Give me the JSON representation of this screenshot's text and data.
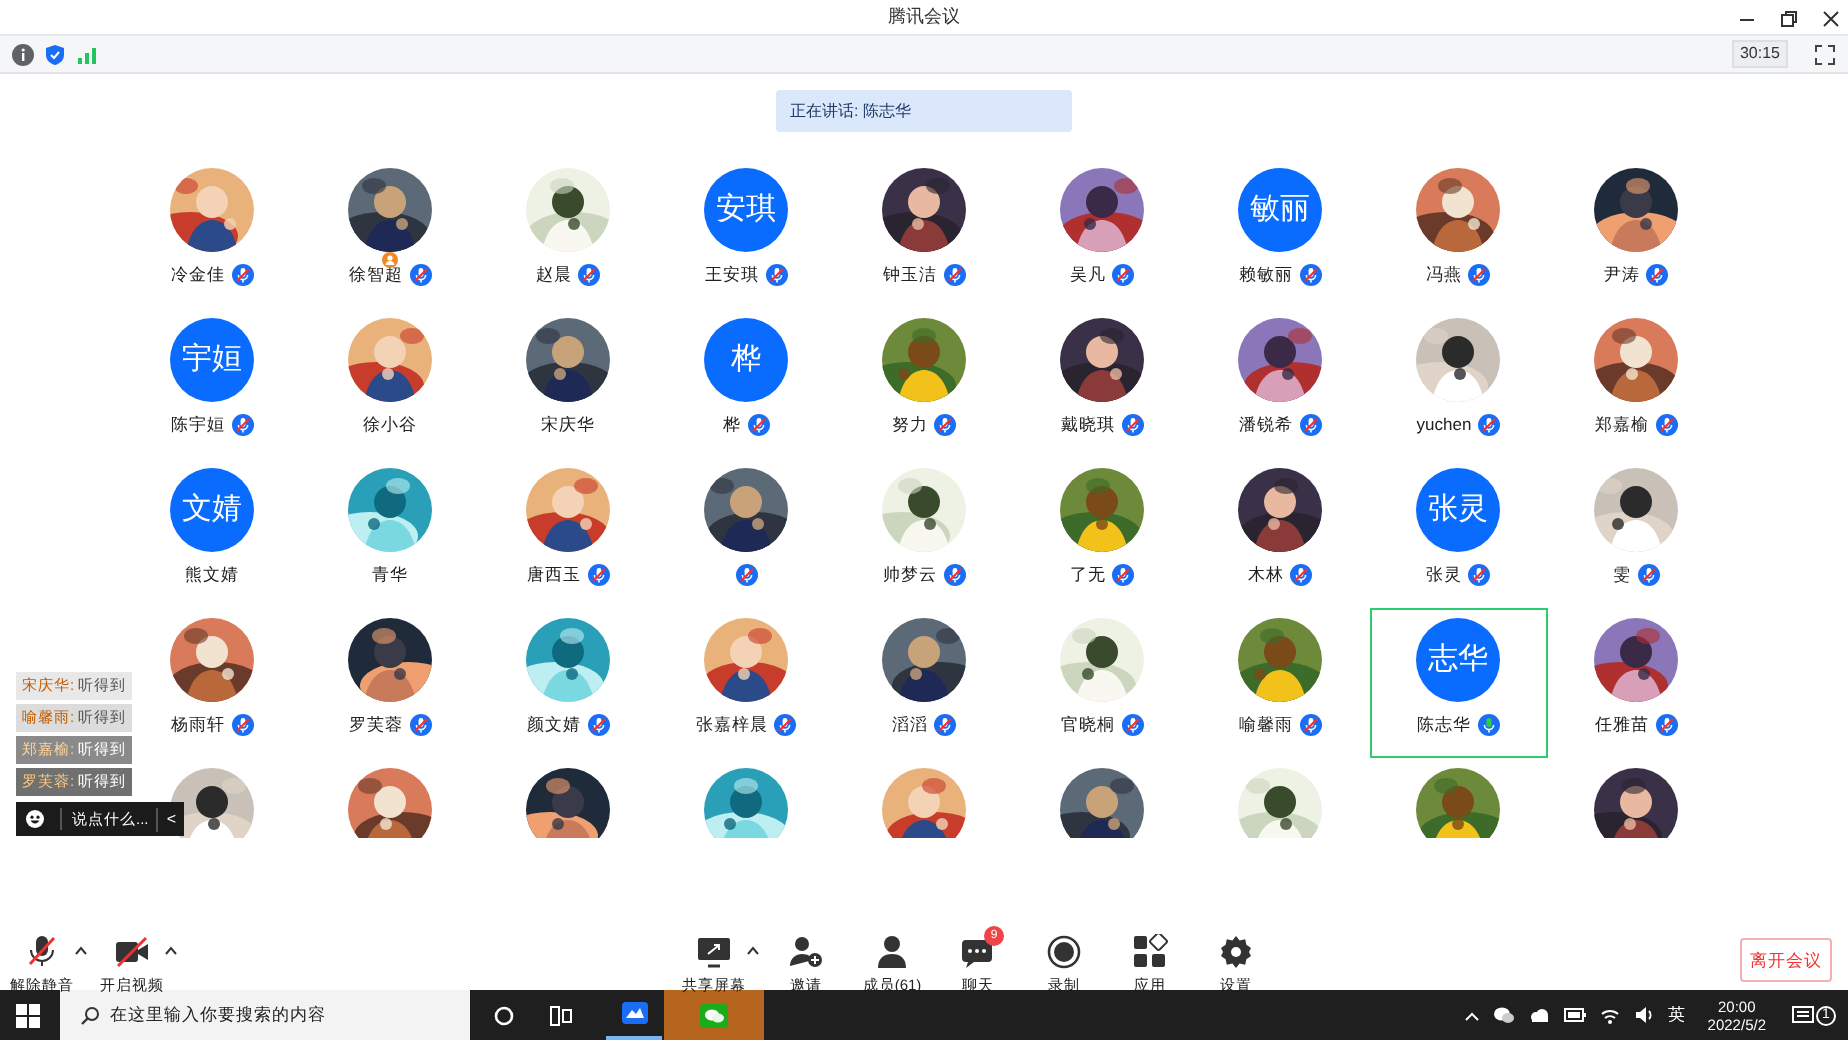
{
  "window": {
    "title": "腾讯会议"
  },
  "meeting_bar": {
    "timer": "30:15"
  },
  "speaking_banner": "正在讲话: 陈志华",
  "participants": [
    {
      "name": "冷金佳",
      "kind": "picture",
      "muted": true,
      "host": false,
      "selected": false
    },
    {
      "name": "徐智超",
      "kind": "picture",
      "muted": true,
      "host": true,
      "selected": false
    },
    {
      "name": "赵晨",
      "kind": "picture",
      "muted": true,
      "host": false,
      "selected": false
    },
    {
      "name": "王安琪",
      "kind": "initials",
      "initials": "安琪",
      "muted": true,
      "host": false,
      "selected": false
    },
    {
      "name": "钟玉洁",
      "kind": "picture",
      "muted": true,
      "host": false,
      "selected": false
    },
    {
      "name": "吴凡",
      "kind": "picture",
      "muted": true,
      "host": false,
      "selected": false
    },
    {
      "name": "赖敏丽",
      "kind": "initials",
      "initials": "敏丽",
      "muted": true,
      "host": false,
      "selected": false
    },
    {
      "name": "冯燕",
      "kind": "picture",
      "muted": true,
      "host": false,
      "selected": false
    },
    {
      "name": "尹涛",
      "kind": "picture",
      "muted": true,
      "host": false,
      "selected": false
    },
    {
      "name": "陈宇姮",
      "kind": "initials",
      "initials": "宇姮",
      "muted": true,
      "host": false,
      "selected": false
    },
    {
      "name": "徐小谷",
      "kind": "picture",
      "host": false,
      "selected": false
    },
    {
      "name": "宋庆华",
      "kind": "picture",
      "host": false,
      "selected": false
    },
    {
      "name": "桦",
      "kind": "initials",
      "initials": "桦",
      "muted": true,
      "host": false,
      "selected": false
    },
    {
      "name": "努力",
      "kind": "picture",
      "muted": true,
      "host": false,
      "selected": false
    },
    {
      "name": "戴晓琪",
      "kind": "picture",
      "muted": true,
      "host": false,
      "selected": false
    },
    {
      "name": "潘锐希",
      "kind": "picture",
      "muted": true,
      "host": false,
      "selected": false
    },
    {
      "name": "yuchen",
      "kind": "picture",
      "muted": true,
      "host": false,
      "selected": false
    },
    {
      "name": "郑嘉榆",
      "kind": "picture",
      "muted": true,
      "host": false,
      "selected": false
    },
    {
      "name": "熊文婧",
      "kind": "initials",
      "initials": "文婧",
      "host": false,
      "selected": false
    },
    {
      "name": "青华",
      "kind": "picture",
      "host": false,
      "selected": false
    },
    {
      "name": "唐西玉",
      "kind": "picture",
      "muted": true,
      "host": false,
      "selected": false
    },
    {
      "kind": "picture",
      "muted": true,
      "host": false,
      "selected": false
    },
    {
      "name": "帅梦云",
      "kind": "picture",
      "muted": true,
      "host": false,
      "selected": false
    },
    {
      "name": "了无",
      "kind": "picture",
      "muted": true,
      "host": false,
      "selected": false
    },
    {
      "name": "木林",
      "kind": "picture",
      "muted": true,
      "host": false,
      "selected": false
    },
    {
      "name": "张灵",
      "kind": "initials",
      "initials": "张灵",
      "muted": true,
      "host": false,
      "selected": false
    },
    {
      "name": "雯",
      "kind": "picture",
      "muted": true,
      "host": false,
      "selected": false
    },
    {
      "name": "杨雨轩",
      "kind": "picture",
      "muted": true,
      "host": false,
      "selected": false
    },
    {
      "name": "罗芙蓉",
      "kind": "picture",
      "muted": true,
      "host": false,
      "selected": false
    },
    {
      "name": "颜文婧",
      "kind": "picture",
      "muted": true,
      "host": false,
      "selected": false
    },
    {
      "name": "张嘉梓晨",
      "kind": "picture",
      "muted": true,
      "host": false,
      "selected": false
    },
    {
      "name": "滔滔",
      "kind": "picture",
      "muted": true,
      "host": false,
      "selected": false
    },
    {
      "name": "官晓桐",
      "kind": "picture",
      "muted": true,
      "host": false,
      "selected": false
    },
    {
      "name": "喻馨雨",
      "kind": "picture",
      "muted": true,
      "host": false,
      "selected": false
    },
    {
      "name": "陈志华",
      "kind": "initials",
      "initials": "志华",
      "muted": false,
      "host": false,
      "selected": true
    },
    {
      "name": "任雅苗",
      "kind": "picture",
      "muted": true,
      "host": false,
      "selected": false
    },
    {
      "kind": "picture",
      "selected": false
    },
    {
      "kind": "picture",
      "selected": false
    },
    {
      "kind": "picture",
      "selected": false
    },
    {
      "kind": "picture",
      "selected": false
    },
    {
      "kind": "picture",
      "selected": false
    },
    {
      "kind": "picture",
      "selected": false
    },
    {
      "kind": "picture",
      "selected": false
    },
    {
      "kind": "picture",
      "selected": false
    },
    {
      "kind": "picture",
      "selected": false
    }
  ],
  "chat_overlay": {
    "messages": [
      {
        "sender": "宋庆华:",
        "text": "听得到"
      },
      {
        "sender": "喻馨雨:",
        "text": "听得到"
      },
      {
        "sender": "郑嘉榆:",
        "text": "听得到"
      },
      {
        "sender": "罗芙蓉:",
        "text": "听得到"
      }
    ],
    "input_placeholder": "说点什么...",
    "collapse": "<"
  },
  "toolbar": {
    "left": [
      {
        "kind": "mic",
        "label": "解除静音",
        "off": true
      },
      {
        "kind": "video",
        "label": "开启视频",
        "off": true
      }
    ],
    "center": [
      {
        "kind": "share",
        "label": "共享屏幕"
      },
      {
        "kind": "invite",
        "label": "邀请"
      },
      {
        "kind": "members",
        "label": "成员(61)"
      },
      {
        "kind": "chat",
        "label": "聊天",
        "badge": "9"
      },
      {
        "kind": "record",
        "label": "录制"
      },
      {
        "kind": "apps",
        "label": "应用"
      },
      {
        "kind": "settings",
        "label": "设置"
      }
    ],
    "leave_button": "离开会议"
  },
  "taskbar": {
    "search_placeholder": "在这里输入你要搜索的内容",
    "ime": "英",
    "time": "20:00",
    "date": "2022/5/2",
    "notifications": "1"
  }
}
